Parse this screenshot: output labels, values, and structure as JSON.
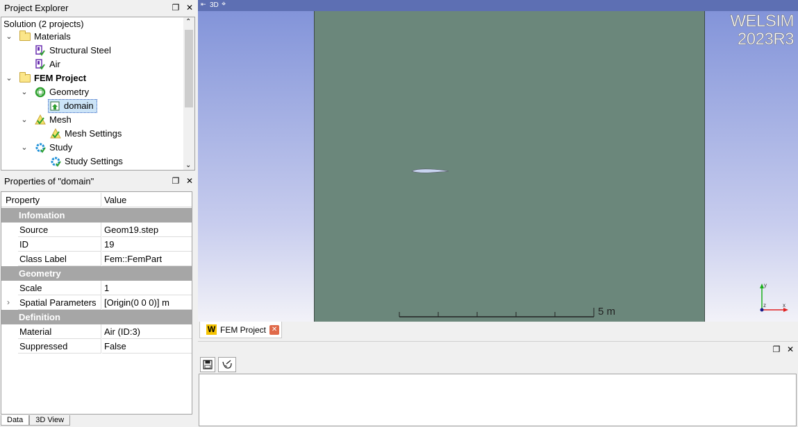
{
  "explorer": {
    "title": "Project Explorer",
    "items": [
      {
        "label": "Solution (2 projects)"
      },
      {
        "label": "Materials"
      },
      {
        "label": "Structural Steel"
      },
      {
        "label": "Air"
      },
      {
        "label": "FEM Project"
      },
      {
        "label": "Geometry"
      },
      {
        "label": "domain"
      },
      {
        "label": "Mesh"
      },
      {
        "label": "Mesh Settings"
      },
      {
        "label": "Study"
      },
      {
        "label": "Study Settings"
      }
    ]
  },
  "properties": {
    "title": "Properties of \"domain\"",
    "col_property": "Property",
    "col_value": "Value",
    "groups": {
      "info": "Infomation",
      "geometry": "Geometry",
      "definition": "Definition"
    },
    "rows": [
      {
        "name": "Source",
        "value": "Geom19.step"
      },
      {
        "name": "ID",
        "value": "19"
      },
      {
        "name": "Class Label",
        "value": "Fem::FemPart"
      },
      {
        "name": "Scale",
        "value": "1"
      },
      {
        "name": "Spatial Parameters",
        "value": "[Origin(0 0 0)] m"
      },
      {
        "name": "Material",
        "value": "Air (ID:3)"
      },
      {
        "name": "Suppressed",
        "value": "False"
      }
    ]
  },
  "bottom_tabs": {
    "data": "Data",
    "view3d": "3D View"
  },
  "viewport": {
    "tag": "3D",
    "watermark_line1": "WELSIM",
    "watermark_line2": "2023R3",
    "scale_label": "5 m",
    "axis_y": "y",
    "axis_x": "x",
    "axis_z": "z",
    "bg_top": "#7f91d8",
    "bg_bottom": "#f2f2f8",
    "domain_color": "#6b877b"
  },
  "doc_tab": {
    "label": "FEM Project",
    "icon": "W"
  },
  "output_pane": {}
}
